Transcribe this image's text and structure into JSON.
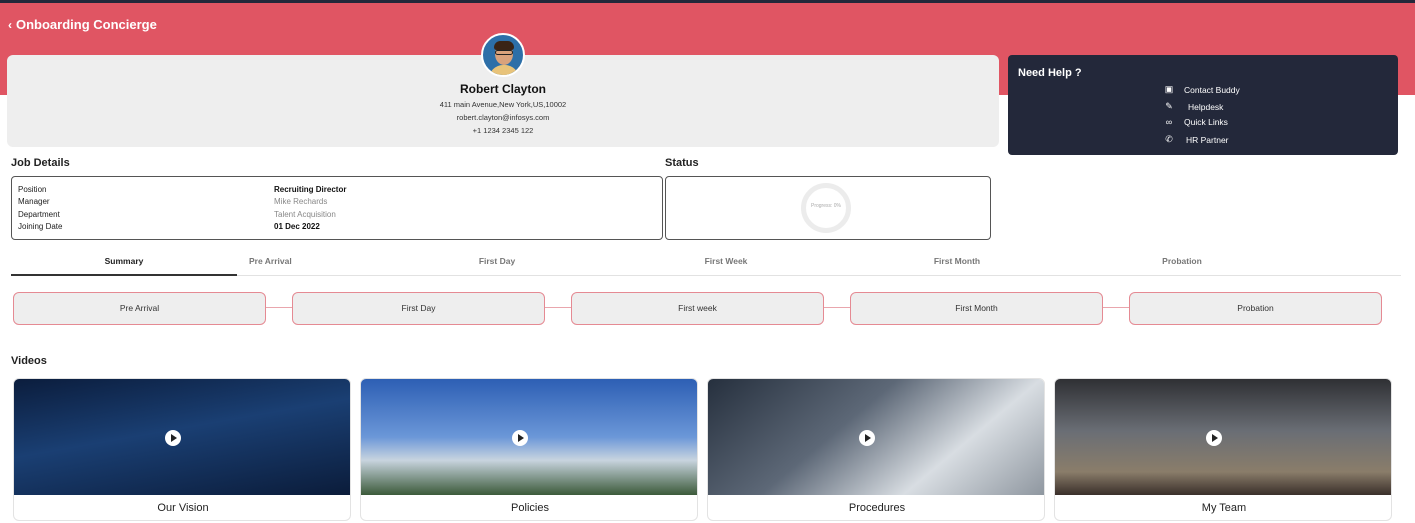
{
  "app": {
    "title": "Onboarding Concierge"
  },
  "profile": {
    "name": "Robert Clayton",
    "address": "411 main Avenue,New York,US,10002",
    "email": "robert.clayton@infosys.com",
    "phone": "+1 1234 2345 122"
  },
  "help": {
    "title": "Need Help ?",
    "items": [
      {
        "label": "Contact Buddy",
        "icon": "contact-card-icon"
      },
      {
        "label": "Helpdesk",
        "icon": "edit-icon"
      },
      {
        "label": "Quick Links",
        "icon": "link-icon"
      },
      {
        "label": "HR Partner",
        "icon": "phone-icon"
      }
    ]
  },
  "job": {
    "title": "Job Details",
    "rows": [
      {
        "label": "Position",
        "value": "Recruiting Director"
      },
      {
        "label": "Manager",
        "value": "Mike Rechards"
      },
      {
        "label": "Department",
        "value": "Talent Acquisition"
      },
      {
        "label": "Joining Date",
        "value": "01 Dec 2022"
      }
    ]
  },
  "status": {
    "title": "Status",
    "progress_text": "Progress: 0%",
    "progress": 0
  },
  "tabs": [
    "Summary",
    "Pre Arrival",
    "First Day",
    "First Week",
    "First Month",
    "Probation"
  ],
  "stages": [
    "Pre Arrival",
    "First Day",
    "First week",
    "First Month",
    "Probation"
  ],
  "videos": {
    "title": "Videos",
    "items": [
      "Our Vision",
      "Policies",
      "Procedures",
      "My Team"
    ]
  },
  "colors": {
    "banner": "#e05563",
    "help_bg": "#23283a",
    "stage_border": "#e58a93"
  }
}
